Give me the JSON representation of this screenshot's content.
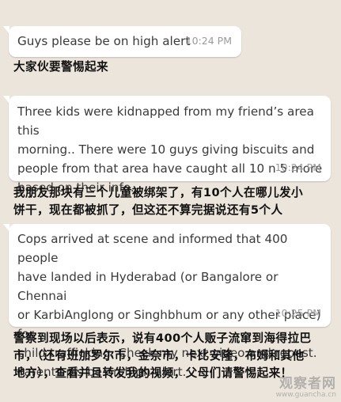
{
  "messages": [
    {
      "text": "Guys please be on high alert",
      "time": "10:24 PM",
      "caption": "大家伙要警惕起来"
    },
    {
      "text": "Three kids were kidnapped from my friend’s area this\nmorning.. There were 10 guys giving biscuits and\npeople from that area have caught all 10 n 5 more\nbased on their info...",
      "time": "10:24 PM",
      "caption": "我朋友那块有三个儿童被绑架了，有10个人在哪儿发小\n饼干，现在都被抓了，但这还不算完据说还有5个人"
    },
    {
      "text": "Cops arrived at scene and informed that 400 people\nhave landed in Hyderabad (or Bangalore or Chennai\nor KarbiAnglong or Singhbhum or any other place) for\nchild trafficking. Check my next video and repost.\nParents pls be on high alert.",
      "time": "10:25 PM",
      "caption": "警察到现场以后表示，说有400个人贩子流窜到海得拉巴\n市，（还有班加罗尔市，金奈市，卡比安隆，布姆和其他\n地方），查看并且转发我的视频，父母们请警惕起来！"
    }
  ],
  "watermark": {
    "name": "观察者网",
    "url": "www.guancha.cn"
  }
}
